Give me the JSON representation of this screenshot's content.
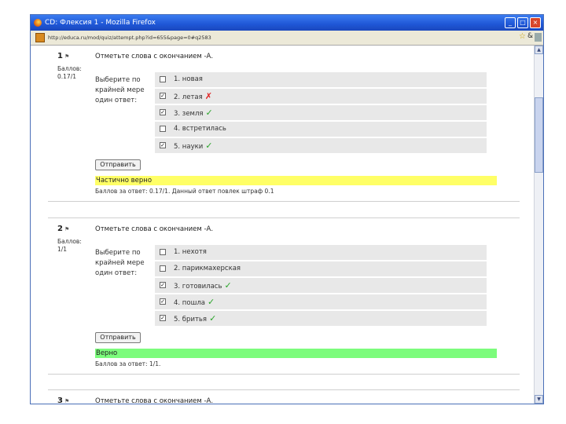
{
  "window": {
    "title": "CD: Флексия 1 - Mozilla Firefox",
    "url": "http://educa.ru/mod/quiz/attempt.php?id=655&page=0#q2583"
  },
  "questions": [
    {
      "number": "1",
      "score_label": "Баллов:",
      "score_value": "0.17/1",
      "text": "Отметьте слова с окончанием -А.",
      "prompt": "Выберите по крайней мере один ответ:",
      "options": [
        {
          "label": "1. новая",
          "checked": false,
          "mark": ""
        },
        {
          "label": "2. летая",
          "checked": true,
          "mark": "wrong"
        },
        {
          "label": "3. земля",
          "checked": true,
          "mark": "correct"
        },
        {
          "label": "4. встретилась",
          "checked": false,
          "mark": ""
        },
        {
          "label": "5. науки",
          "checked": true,
          "mark": "correct"
        }
      ],
      "submit_label": "Отправить",
      "feedback": "Частично верно",
      "feedback_type": "partial",
      "grade_info": "Баллов за ответ: 0.17/1. Данный ответ повлек штраф 0.1"
    },
    {
      "number": "2",
      "score_label": "Баллов: 1/1",
      "score_value": "",
      "text": "Отметьте слова с окончанием -А.",
      "prompt": "Выберите по крайней мере один ответ:",
      "options": [
        {
          "label": "1. нехотя",
          "checked": false,
          "mark": ""
        },
        {
          "label": "2. парикмахерская",
          "checked": false,
          "mark": ""
        },
        {
          "label": "3. готовилась",
          "checked": true,
          "mark": "correct"
        },
        {
          "label": "4. пошла",
          "checked": true,
          "mark": "correct"
        },
        {
          "label": "5. бритья",
          "checked": true,
          "mark": "correct"
        }
      ],
      "submit_label": "Отправить",
      "feedback": "Верно",
      "feedback_type": "correct",
      "grade_info": "Баллов за ответ: 1/1."
    },
    {
      "number": "3",
      "text": "Отметьте слова с окончанием -А."
    }
  ]
}
